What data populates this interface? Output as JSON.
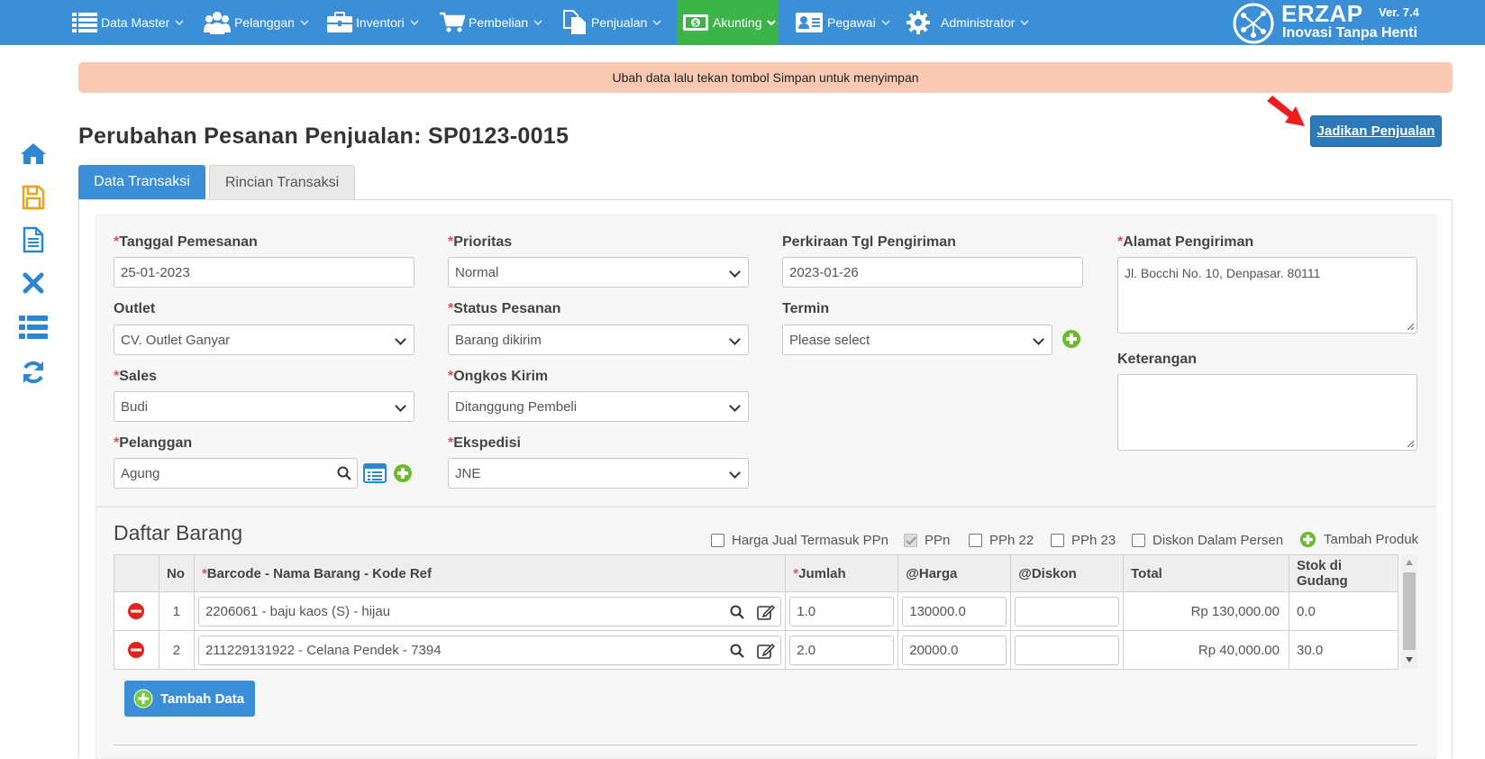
{
  "nav": {
    "items": [
      {
        "label": "Data Master",
        "icon": "list-icon"
      },
      {
        "label": "Pelanggan",
        "icon": "users-icon"
      },
      {
        "label": "Inventori",
        "icon": "briefcase-icon"
      },
      {
        "label": "Pembelian",
        "icon": "cart-icon"
      },
      {
        "label": "Penjualan",
        "icon": "documents-icon"
      },
      {
        "label": "Akunting",
        "icon": "money-icon"
      },
      {
        "label": "Pegawai",
        "icon": "id-card-icon"
      },
      {
        "label": "Administrator",
        "icon": "gear-icon"
      }
    ],
    "brand_name": "ERZAP",
    "brand_tagline": "Inovasi Tanpa Henti",
    "version": "Ver. 7.4"
  },
  "alert": "Ubah data lalu tekan tombol Simpan untuk menyimpan",
  "title": "Perubahan Pesanan Penjualan: SP0123-0015",
  "jadikan_label": "Jadikan Penjualan",
  "tabs": [
    "Data Transaksi",
    "Rincian Transaksi"
  ],
  "form": {
    "tanggal_label": "Tanggal Pemesanan",
    "tanggal_value": "25-01-2023",
    "prioritas_label": "Prioritas",
    "prioritas_value": "Normal",
    "perkiraan_label": "Perkiraan Tgl Pengiriman",
    "perkiraan_value": "2023-01-26",
    "alamat_label": "Alamat Pengiriman",
    "alamat_value": "Jl. Bocchi No. 10, Denpasar. 80111",
    "outlet_label": "Outlet",
    "outlet_value": "CV. Outlet Ganyar",
    "status_label": "Status Pesanan",
    "status_value": "Barang dikirim",
    "termin_label": "Termin",
    "termin_value": "Please select",
    "keterangan_label": "Keterangan",
    "keterangan_value": "",
    "sales_label": "Sales",
    "sales_value": "Budi",
    "ongkos_label": "Ongkos Kirim",
    "ongkos_value": "Ditanggung Pembeli",
    "pelanggan_label": "Pelanggan",
    "pelanggan_value": "Agung",
    "ekspedisi_label": "Ekspedisi",
    "ekspedisi_value": "JNE"
  },
  "daftar": {
    "title": "Daftar Barang",
    "checks": {
      "harga_ppn": "Harga Jual Termasuk PPn",
      "ppn": "PPn",
      "pph22": "PPh 22",
      "pph23": "PPh 23",
      "diskon_persen": "Diskon Dalam Persen",
      "tambah_produk": "Tambah Produk"
    },
    "headers": {
      "no": "No",
      "barcode": "Barcode - Nama Barang - Kode Ref",
      "jumlah": "Jumlah",
      "harga": "@Harga",
      "diskon": "@Diskon",
      "total": "Total",
      "stok": "Stok di Gudang"
    },
    "rows": [
      {
        "no": "1",
        "barang": "2206061 - baju kaos (S) - hijau",
        "jumlah": "1.0",
        "harga": "130000.0",
        "diskon": "",
        "total": "Rp 130,000.00",
        "stok": "0.0"
      },
      {
        "no": "2",
        "barang": "211229131922 - Celana Pendek - 7394",
        "jumlah": "2.0",
        "harga": "20000.0",
        "diskon": "",
        "total": "Rp 40,000.00",
        "stok": "30.0"
      }
    ],
    "tambah_data": "Tambah Data"
  }
}
